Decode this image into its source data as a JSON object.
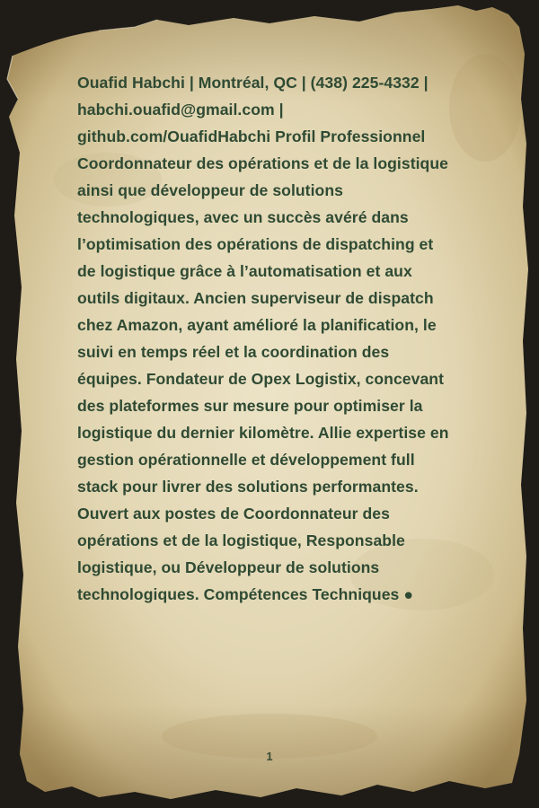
{
  "document": {
    "body_text": "Ouafid Habchi | Montréal, QC | (438) 225-4332 | habchi.ouafid@gmail.com | github.com/OuafidHabchi Profil Professionnel Coordonnateur des opérations et de la logistique ainsi que développeur de solutions technologiques, avec un succès avéré dans l’optimisation des opérations de dispatching et de logistique grâce à l’automatisation et aux outils digitaux. Ancien superviseur de dispatch chez Amazon, ayant amélioré la planification, le suivi en temps réel et la coordination des équipes. Fondateur de Opex Logistix, concevant des plateformes sur mesure pour optimiser la logistique du dernier kilomètre. Allie expertise en gestion opérationnelle et développement full stack pour livrer des solutions performantes. Ouvert aux postes de Coordonnateur des opérations et de la logistique, Responsable logistique, ou Développeur de solutions technologiques. Compétences Techniques ●",
    "page_number": "1"
  },
  "colors": {
    "text": "#2f4a33",
    "paper": "#e4d9b8",
    "background": "#1f1c18"
  }
}
